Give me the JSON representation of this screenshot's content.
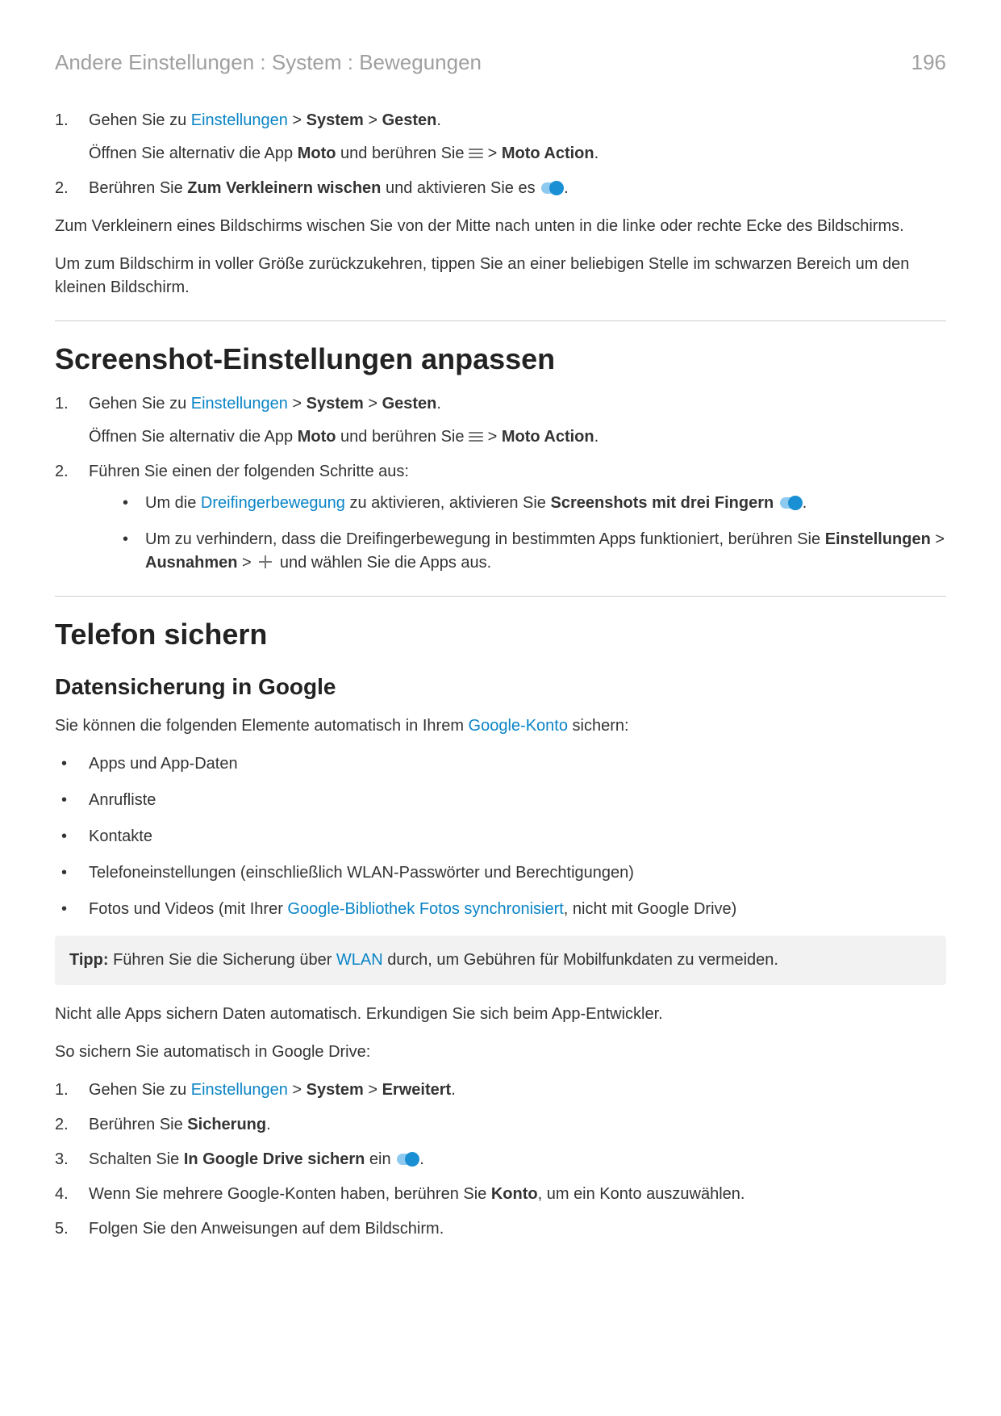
{
  "header": {
    "breadcrumb": "Andere Einstellungen : System : Bewegungen",
    "page": "196"
  },
  "intro": {
    "step1_pre": "Gehen Sie zu ",
    "step1_link": "Einstellungen",
    "step1_gt1": " > ",
    "step1_b1": "System",
    "step1_gt2": " > ",
    "step1_b2": "Gesten",
    "step1_end": ".",
    "step1_sub_pre": "Öffnen Sie alternativ die App ",
    "step1_sub_b1": "Moto",
    "step1_sub_mid": " und berühren Sie ",
    "step1_sub_gt": " > ",
    "step1_sub_b2": "Moto Action",
    "step1_sub_end": ".",
    "step2_pre": "Berühren Sie ",
    "step2_b": "Zum Verkleinern wischen",
    "step2_mid": " und aktivieren Sie es ",
    "step2_end": ".",
    "p1": "Zum Verkleinern eines Bildschirms wischen Sie von der Mitte nach unten in die linke oder rechte Ecke des Bildschirms.",
    "p2": "Um zum Bildschirm in voller Größe zurückzukehren, tippen Sie an einer beliebigen Stelle im schwarzen Bereich um den kleinen Bildschirm."
  },
  "sec1": {
    "title": "Screenshot-Einstellungen anpassen",
    "step1_pre": "Gehen Sie zu ",
    "step1_link": "Einstellungen",
    "step1_gt1": " > ",
    "step1_b1": "System",
    "step1_gt2": " > ",
    "step1_b2": "Gesten",
    "step1_end": ".",
    "step1_sub_pre": "Öffnen Sie alternativ die App ",
    "step1_sub_b1": "Moto",
    "step1_sub_mid": " und berühren Sie ",
    "step1_sub_gt": " > ",
    "step1_sub_b2": "Moto Action",
    "step1_sub_end": ".",
    "step2": "Führen Sie einen der folgenden Schritte aus:",
    "b1_pre": "Um die ",
    "b1_link": "Dreifingerbewegung",
    "b1_mid": " zu aktivieren, aktivieren Sie ",
    "b1_b": "Screenshots mit drei Fingern",
    "b1_end": ".",
    "b2_pre": "Um zu verhindern, dass die Dreifingerbewegung in bestimmten Apps funktioniert, berühren Sie ",
    "b2_b1": "Einstellungen",
    "b2_gt1": " > ",
    "b2_b2": "Ausnahmen",
    "b2_gt2": " > ",
    "b2_end": " und wählen Sie die Apps aus."
  },
  "sec2": {
    "title": "Telefon sichern",
    "sub": "Datensicherung in Google",
    "p1_pre": "Sie können die folgenden Elemente automatisch in Ihrem ",
    "p1_link": "Google-Konto",
    "p1_end": " sichern:",
    "li1": "Apps und App-Daten",
    "li2": "Anrufliste",
    "li3": "Kontakte",
    "li4": "Telefoneinstellungen (einschließlich WLAN-Passwörter und Berechtigungen)",
    "li5_pre": "Fotos und Videos (mit Ihrer ",
    "li5_link": "Google-Bibliothek Fotos synchronisiert",
    "li5_end": ", nicht mit Google Drive)",
    "tip_label": "Tipp:",
    "tip_pre": " Führen Sie die Sicherung über ",
    "tip_link": "WLAN",
    "tip_end": " durch, um Gebühren für Mobilfunkdaten zu vermeiden.",
    "p2": "Nicht alle Apps sichern Daten automatisch. Erkundigen Sie sich beim App-Entwickler.",
    "p3": "So sichern Sie automatisch in Google Drive:",
    "os1_pre": "Gehen Sie zu ",
    "os1_link": "Einstellungen",
    "os1_gt1": " > ",
    "os1_b1": "System",
    "os1_gt2": " > ",
    "os1_b2": "Erweitert",
    "os1_end": ".",
    "os2_pre": "Berühren Sie ",
    "os2_b": "Sicherung",
    "os2_end": ".",
    "os3_pre": "Schalten Sie ",
    "os3_b": "In Google Drive sichern",
    "os3_mid": " ein ",
    "os3_end": ".",
    "os4_pre": "Wenn Sie mehrere Google-Konten haben, berühren Sie ",
    "os4_b": "Konto",
    "os4_end": ", um ein Konto auszuwählen.",
    "os5": "Folgen Sie den Anweisungen auf dem Bildschirm."
  }
}
